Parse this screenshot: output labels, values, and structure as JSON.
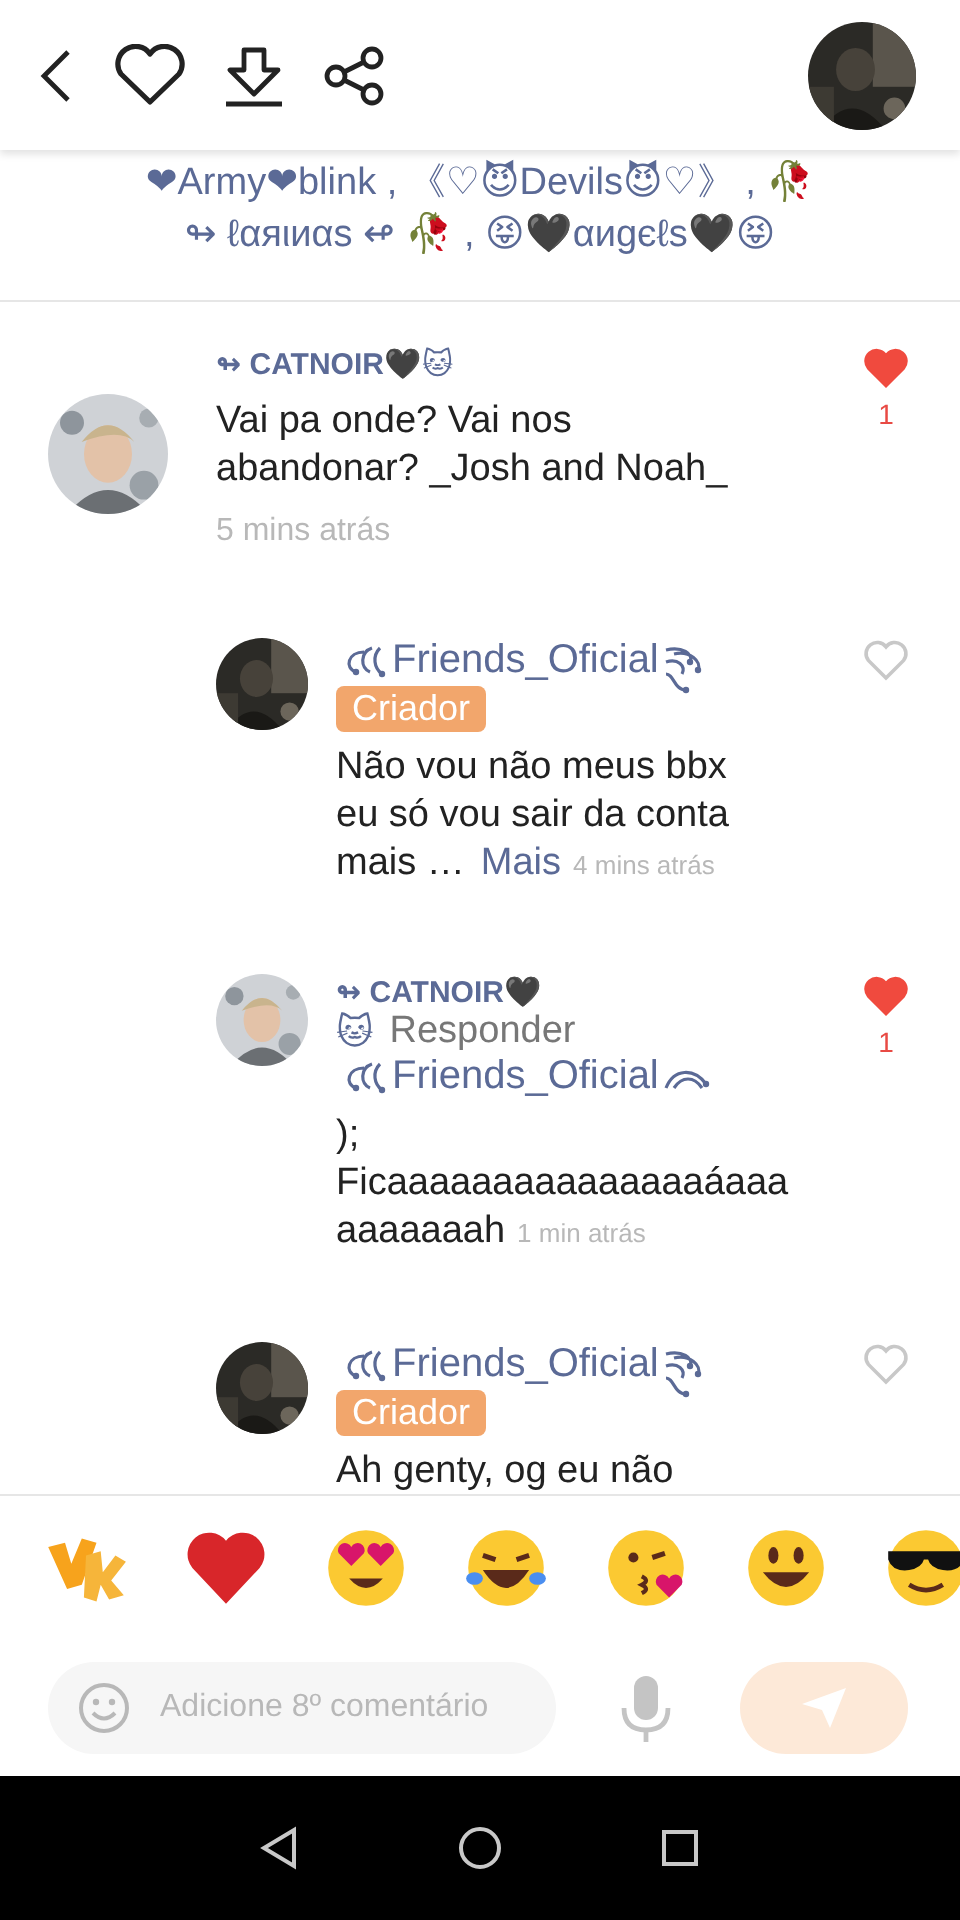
{
  "toolbar": {
    "liked": false
  },
  "bio_lines": [
    "❤Army❤blink , 《♡😈Devils😈♡》 , 🥀",
    "↬ ℓαяιиαѕ ↫ 🥀 , 😝🖤αиgєℓѕ🖤😝"
  ],
  "comments": [
    {
      "kind": "top",
      "author": "↬ CATNOIR🖤🐱",
      "swirls": false,
      "text": "Vai pa onde? Vai nos\nabandonar? _Josh and Noah_",
      "time": "5 mins atrás",
      "liked": true,
      "likes": "1"
    },
    {
      "kind": "reply",
      "author": "Friends_Oficial",
      "swirls": true,
      "badge": "Criador",
      "text": "Não vou não meus bbx\neu só vou sair da conta\nmais …",
      "more": "Mais",
      "time": "4 mins atrás",
      "liked": false
    },
    {
      "kind": "reply",
      "author": "↬ CATNOIR🖤",
      "swirls": false,
      "reply_prefix": "🐱",
      "reply_label": "Responder",
      "mention": "Friends_Oficial",
      "text": ");\nFicaaaaaaaaaaaaaaaáaaa\naaaaaaah",
      "time": "1 min atrás",
      "liked": true,
      "likes": "1"
    },
    {
      "kind": "reply",
      "author": "Friends_Oficial",
      "swirls": true,
      "badge": "Criador",
      "text": "Ah genty, og eu não",
      "liked": false
    }
  ],
  "reactions": [
    {
      "kind": "sticker"
    },
    {
      "kind": "heart"
    },
    {
      "kind": "heart-eyes"
    },
    {
      "kind": "tears-of-joy"
    },
    {
      "kind": "kiss"
    },
    {
      "kind": "smile"
    },
    {
      "kind": "sunglasses"
    }
  ],
  "composer": {
    "placeholder": "Adicione 8º comentário",
    "send_disabled": true
  }
}
